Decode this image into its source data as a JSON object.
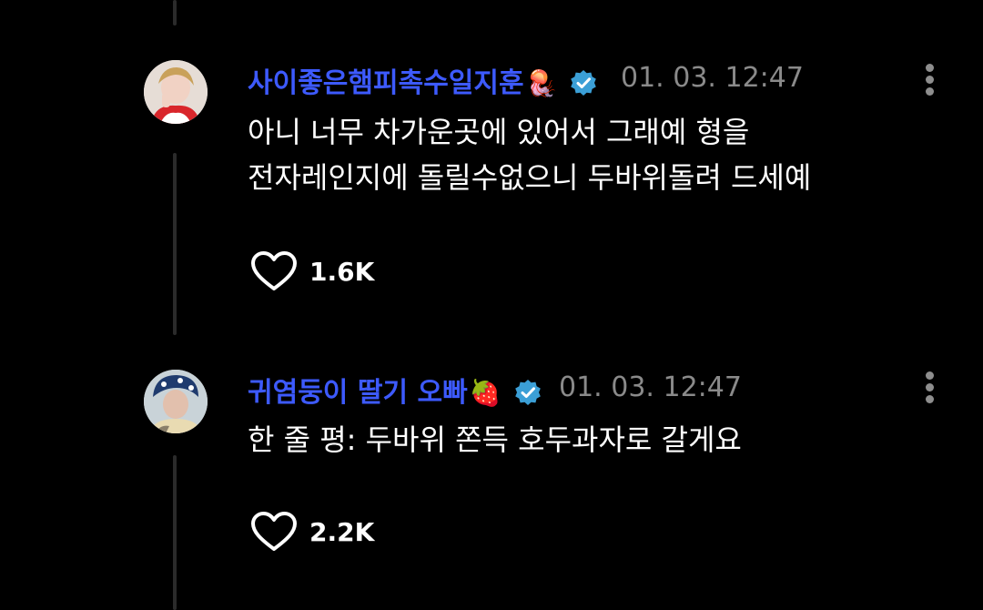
{
  "comments": [
    {
      "username": "사이좋은햄피촉수일지훈",
      "name_emoji": "🪼",
      "timestamp": "01. 03. 12:47",
      "text_lines": [
        "아니 너무 차가운곳에 있어서 그래예 형을",
        "전자레인지에 돌릴수없으니 두바위돌려 드세예"
      ],
      "likes": "1.6K"
    },
    {
      "username": "귀염둥이 딸기 오빠",
      "name_emoji": "🍓",
      "timestamp": "01. 03. 12:47",
      "text_lines": [
        "한 줄 평: 두바위 쫀득 호두과자로 갈게요"
      ],
      "likes": "2.2K"
    }
  ],
  "colors": {
    "background": "#000000",
    "username": "#3d5afe",
    "verified_badge": "#3b9fd6",
    "timestamp": "#8a8a8a",
    "thread_line": "#2b2b2b"
  },
  "icons": [
    "verified-badge-icon",
    "more-options-icon",
    "heart-icon"
  ]
}
